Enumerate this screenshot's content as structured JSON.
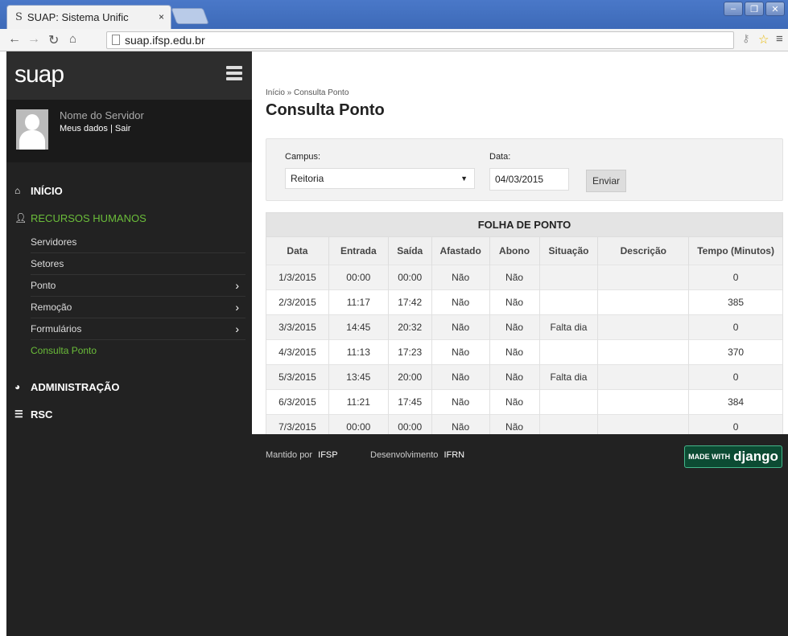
{
  "browser": {
    "tab_title": "SUAP: Sistema Unific",
    "tab_close": "×",
    "url": "suap.ifsp.edu.br"
  },
  "sidebar": {
    "logo": "suap",
    "user_name": "Nome do Servidor",
    "user_links": "Meus dados | Sair",
    "sections": {
      "inicio": "INÍCIO",
      "rh": "RECURSOS HUMANOS",
      "admin": "ADMINISTRAÇÃO",
      "rsc": "RSC"
    },
    "rh_items": [
      "Servidores",
      "Setores",
      "Ponto",
      "Remoção",
      "Formulários",
      "Consulta Ponto"
    ]
  },
  "main": {
    "breadcrumb": "Início » Consulta Ponto",
    "title": "Consulta Ponto",
    "form": {
      "campus_label": "Campus:",
      "campus_value": "Reitoria",
      "data_label": "Data:",
      "data_value": "04/03/2015",
      "submit_label": "Enviar"
    },
    "table": {
      "caption": "FOLHA DE PONTO",
      "headers": [
        "Data",
        "Entrada",
        "Saída",
        "Afastado",
        "Abono",
        "Situação",
        "Descrição",
        "Tempo (Minutos)"
      ],
      "rows": [
        [
          "1/3/2015",
          "00:00",
          "00:00",
          "Não",
          "Não",
          "",
          "",
          "0"
        ],
        [
          "2/3/2015",
          "11:17",
          "17:42",
          "Não",
          "Não",
          "",
          "",
          "385"
        ],
        [
          "3/3/2015",
          "14:45",
          "20:32",
          "Não",
          "Não",
          "Falta dia",
          "",
          "0"
        ],
        [
          "4/3/2015",
          "11:13",
          "17:23",
          "Não",
          "Não",
          "",
          "",
          "370"
        ],
        [
          "5/3/2015",
          "13:45",
          "20:00",
          "Não",
          "Não",
          "Falta dia",
          "",
          "0"
        ],
        [
          "6/3/2015",
          "11:21",
          "17:45",
          "Não",
          "Não",
          "",
          "",
          "384"
        ],
        [
          "7/3/2015",
          "00:00",
          "00:00",
          "Não",
          "Não",
          "",
          "",
          "0"
        ]
      ]
    }
  },
  "footer": {
    "mantido_label": "Mantido por",
    "mantido_value": "IFSP",
    "dev_label": "Desenvolvimento",
    "dev_value": "IFRN",
    "badge_small": "MADE WITH",
    "badge_big": "django"
  },
  "colors": {
    "accent_green": "#6bbd3a",
    "sidebar_bg": "#222222"
  }
}
